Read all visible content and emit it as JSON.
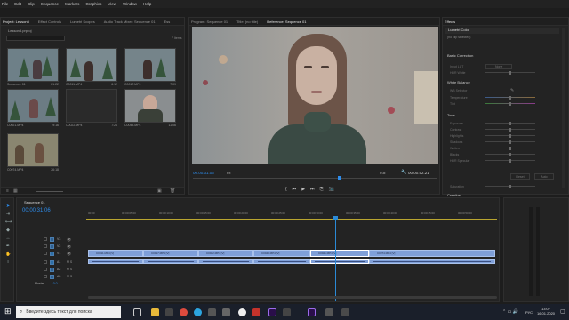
{
  "menu": [
    "File",
    "Edit",
    "Clip",
    "Sequence",
    "Markers",
    "Graphics",
    "View",
    "Window",
    "Help"
  ],
  "project_panel": {
    "tabs": [
      "Project: Lesson5",
      "Effect Controls",
      "Lumetri Scopes",
      "Audio Track Mixer: Sequence 01",
      "Ess"
    ],
    "file_name": "Lesson5.prproj",
    "item_count": "7 Items",
    "clips": [
      {
        "name": "Sequence 01",
        "duration": "21:22"
      },
      {
        "name": "C0011.MP4",
        "duration": "6:12"
      },
      {
        "name": "C0017.MP4",
        "duration": "7:09"
      },
      {
        "name": "C0021.MP4",
        "duration": "9:16"
      },
      {
        "name": "C0022.MP4",
        "duration": "7:24"
      },
      {
        "name": "C0043.MP4",
        "duration": "11:06"
      },
      {
        "name": "C0074.MP4",
        "duration": "26:18"
      }
    ]
  },
  "monitor": {
    "tabs": [
      "Program: Sequence 01",
      "Title: (no title)",
      "Reference: Sequence 01"
    ],
    "timecode": "00:00:31:06",
    "fit": "Fit",
    "quality": "Full",
    "duration": "00:00:52:21"
  },
  "effects_panel": {
    "tab": "Effects",
    "lumetri_tab": "Lumetri Color",
    "no_clip": "(no clip selected)",
    "sections": [
      "Basic Correction",
      "White Balance",
      "Tone"
    ],
    "basic_rows": [
      "Input LUT",
      "HDR White"
    ],
    "wb_rows": [
      "WB Selector",
      "Temperature",
      "Tint"
    ],
    "tone_rows": [
      "Exposure",
      "Contrast",
      "Highlights",
      "Shadows",
      "Whites",
      "Blacks",
      "HDR Specular"
    ],
    "saturation": "Saturation",
    "buttons": [
      "Reset",
      "Auto"
    ],
    "creative": "Creative",
    "input_lut_value": "None"
  },
  "timeline": {
    "tab": "Sequence 01",
    "timecode": "00:00:31:06",
    "ruler": [
      "00:00",
      "00:00:05:00",
      "00:00:10:00",
      "00:00:15:00",
      "00:00:20:00",
      "00:00:25:00",
      "00:00:30:00",
      "00:00:35:00",
      "00:00:40:00",
      "00:00:45:00",
      "00:00:50:00"
    ],
    "video_tracks": [
      "V3",
      "V2",
      "V1"
    ],
    "audio_tracks": [
      "A1",
      "A2",
      "A3"
    ],
    "master": "Master",
    "master_value": "0.0",
    "clips": [
      "C0011.MP4 [V]",
      "C0017.MP4 [V]",
      "C0022.MP4 [V]",
      "C0043.MP4 [V]",
      "C0021.MP4 [V]",
      "C0074.MP4 [V]"
    ]
  },
  "taskbar": {
    "search_placeholder": "Введите здесь текст для поиска",
    "lang": "РУС",
    "time": "13:07",
    "date": "16.01.2020"
  },
  "colors": {
    "clip": "#7f9fd8",
    "playhead": "#2b8ad6",
    "accent": "#2d8ceb"
  }
}
